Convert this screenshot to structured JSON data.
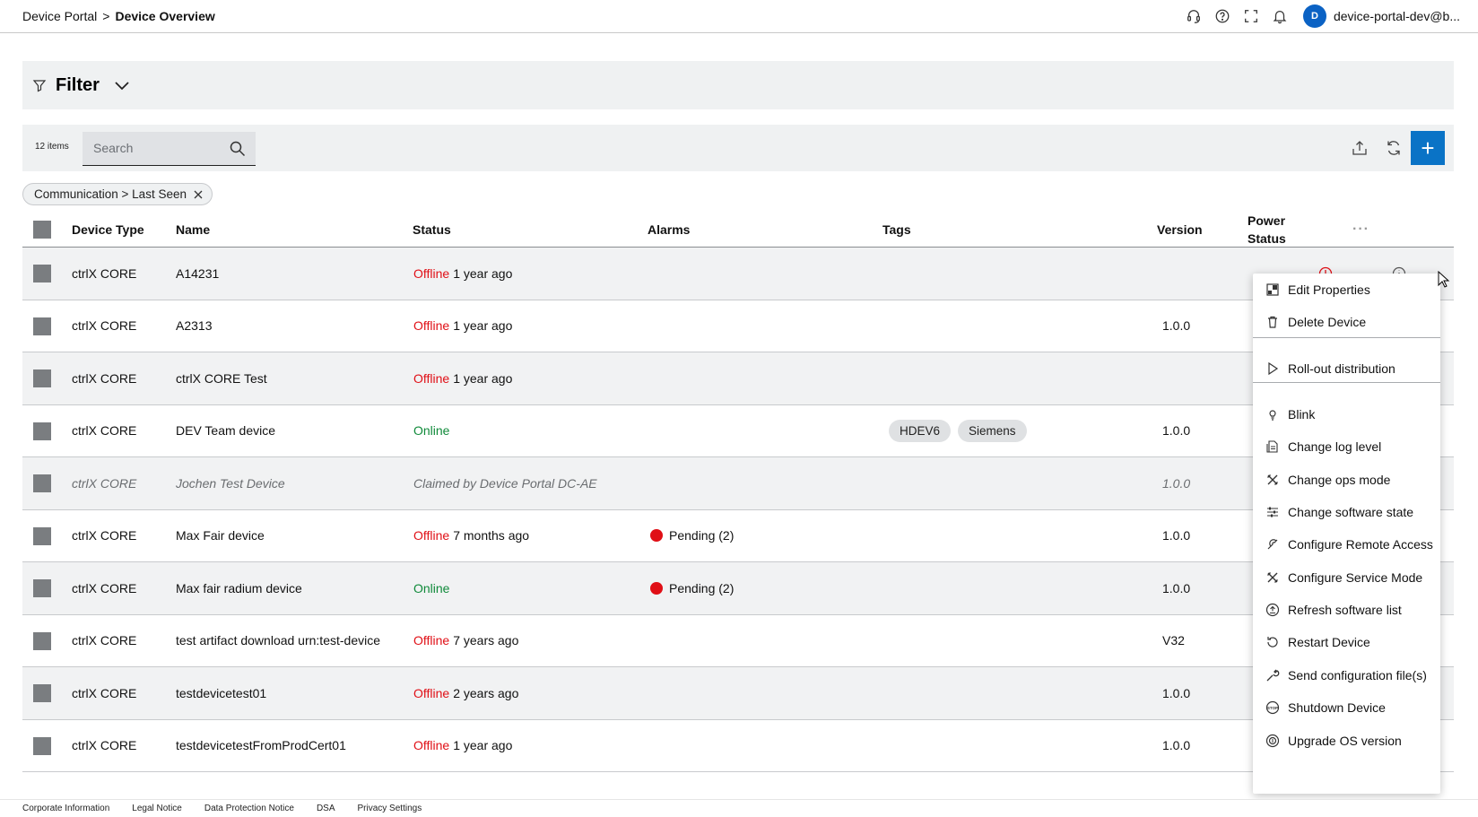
{
  "header": {
    "breadcrumb_root": "Device Portal",
    "breadcrumb_sep": ">",
    "breadcrumb_current": "Device Overview",
    "avatar_letter": "D",
    "user_name": "device-portal-dev@b...",
    "icons": [
      "headset-icon",
      "help-icon",
      "fullscreen-icon",
      "bell-icon"
    ]
  },
  "filter": {
    "title": "Filter"
  },
  "toolbar": {
    "items_count": "12 items",
    "search_placeholder": "Search",
    "add_label": "+"
  },
  "chip": {
    "label": "Communication > Last Seen"
  },
  "table": {
    "columns": {
      "device_type": "Device Type",
      "name": "Name",
      "status": "Status",
      "alarms": "Alarms",
      "tags": "Tags",
      "version": "Version",
      "power_status": "Power Status",
      "more": "···"
    },
    "rows": [
      {
        "device_type": "ctrlX CORE",
        "name": "A14231",
        "status_state": "Offline",
        "status_time": "1 year ago",
        "alarms": "",
        "tags": [],
        "version": ""
      },
      {
        "device_type": "ctrlX CORE",
        "name": "A2313",
        "status_state": "Offline",
        "status_time": "1 year ago",
        "alarms": "",
        "tags": [],
        "version": "1.0.0"
      },
      {
        "device_type": "ctrlX CORE",
        "name": "ctrlX CORE Test",
        "status_state": "Offline",
        "status_time": "1 year ago",
        "alarms": "",
        "tags": [],
        "version": ""
      },
      {
        "device_type": "ctrlX CORE",
        "name": "DEV Team device",
        "status_state": "Online",
        "status_time": "",
        "alarms": "",
        "tags": [
          "HDEV6",
          "Siemens"
        ],
        "version": "1.0.0"
      },
      {
        "device_type": "ctrlX CORE",
        "name": "Jochen Test Device",
        "status_state": "",
        "status_time": "Claimed by Device Portal DC-AE",
        "alarms": "",
        "tags": [],
        "version": "1.0.0"
      },
      {
        "device_type": "ctrlX CORE",
        "name": "Max Fair device",
        "status_state": "Offline",
        "status_time": "7 months ago",
        "alarms": "Pending (2)",
        "tags": [],
        "version": "1.0.0"
      },
      {
        "device_type": "ctrlX CORE",
        "name": "Max fair radium device",
        "status_state": "Online",
        "status_time": "",
        "alarms": "Pending (2)",
        "tags": [],
        "version": "1.0.0"
      },
      {
        "device_type": "ctrlX CORE",
        "name": "test artifact download urn:test-device",
        "status_state": "Offline",
        "status_time": "7 years ago",
        "alarms": "",
        "tags": [],
        "version": "V32"
      },
      {
        "device_type": "ctrlX CORE",
        "name": "testdevicetest01",
        "status_state": "Offline",
        "status_time": "2 years ago",
        "alarms": "",
        "tags": [],
        "version": "1.0.0"
      },
      {
        "device_type": "ctrlX CORE",
        "name": "testdevicetestFromProdCert01",
        "status_state": "Offline",
        "status_time": "1 year ago",
        "alarms": "",
        "tags": [],
        "version": "1.0.0"
      }
    ]
  },
  "context_menu": {
    "items": [
      {
        "label": "Edit Properties",
        "icon": "edit-properties-icon"
      },
      {
        "label": "Delete Device",
        "icon": "trash-icon"
      },
      {
        "label": "Roll-out distribution",
        "icon": "play-icon"
      },
      {
        "label": "Blink",
        "icon": "bulb-icon"
      },
      {
        "label": "Change log level",
        "icon": "log-icon"
      },
      {
        "label": "Change ops mode",
        "icon": "tools-icon"
      },
      {
        "label": "Change software state",
        "icon": "sliders-icon"
      },
      {
        "label": "Configure Remote Access",
        "icon": "remote-icon"
      },
      {
        "label": "Configure Service Mode",
        "icon": "tools-icon"
      },
      {
        "label": "Refresh software list",
        "icon": "refresh-circle-icon"
      },
      {
        "label": "Restart Device",
        "icon": "restart-icon"
      },
      {
        "label": "Send configuration file(s)",
        "icon": "wrench-icon"
      },
      {
        "label": "Shutdown Device",
        "icon": "stop-icon"
      },
      {
        "label": "Upgrade OS version",
        "icon": "upgrade-icon"
      }
    ]
  },
  "footer": {
    "links": [
      "Corporate Information",
      "Legal Notice",
      "Data Protection Notice",
      "DSA",
      "Privacy Settings"
    ]
  },
  "colors": {
    "accent": "#0a73c6",
    "offline": "#e00f16",
    "online": "#108a3a",
    "panel": "#eff1f2"
  }
}
